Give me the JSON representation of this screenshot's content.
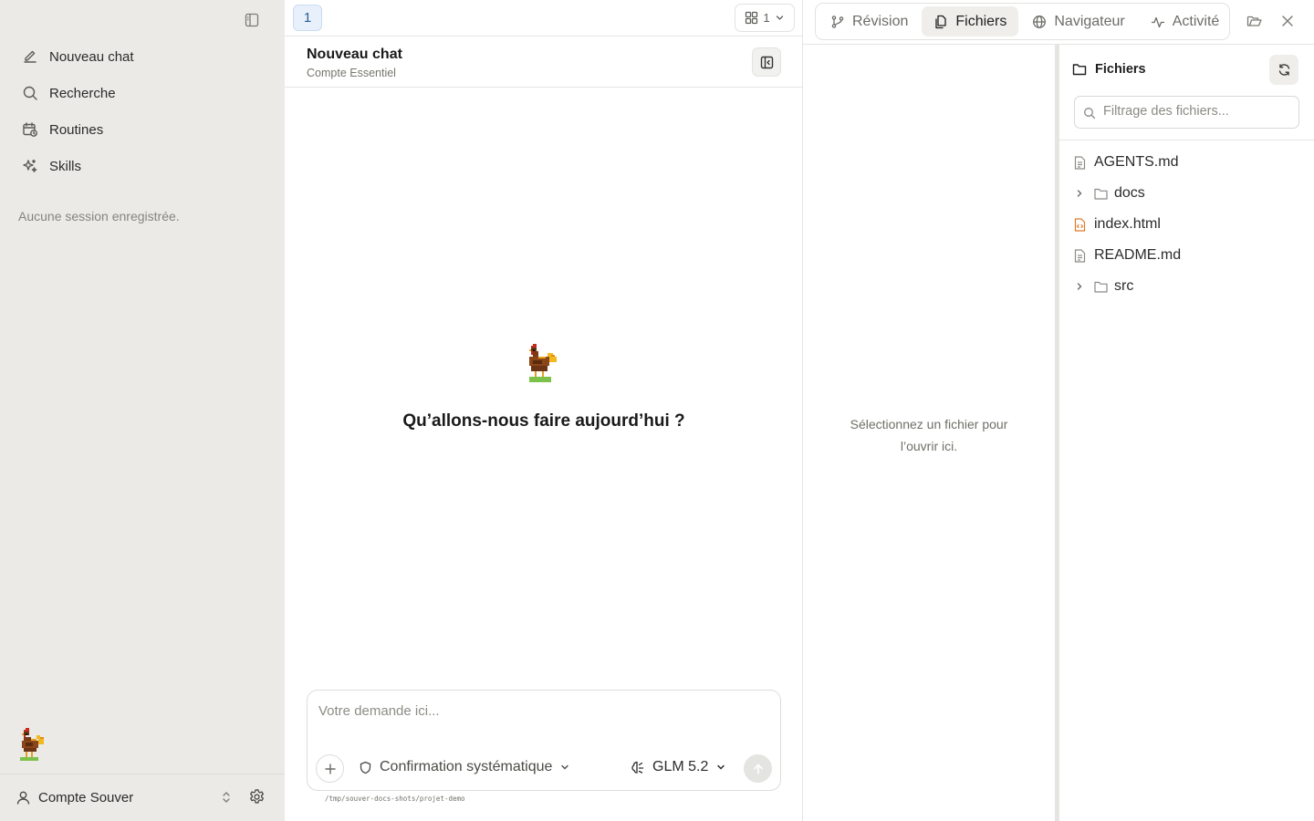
{
  "sidebar": {
    "nav": [
      {
        "label": "Nouveau chat",
        "icon": "pencil-icon"
      },
      {
        "label": "Recherche",
        "icon": "search-icon"
      },
      {
        "label": "Routines",
        "icon": "calendar-clock-icon"
      },
      {
        "label": "Skills",
        "icon": "sparkles-icon"
      }
    ],
    "empty_sessions": "Aucune session enregistrée.",
    "account_name": "Compte Souver"
  },
  "chat": {
    "tab_number": "1",
    "grid_count": "1",
    "title": "Nouveau chat",
    "subtitle": "Compte Essentiel",
    "welcome": "Qu’allons-nous faire aujourd’hui ?",
    "composer_placeholder": "Votre demande ici...",
    "confirmation_mode": "Confirmation systématique",
    "model": "GLM 5.2",
    "workspace_path": "/tmp/souver-docs-shots/projet-demo"
  },
  "right_panel": {
    "tabs": [
      {
        "label": "Révision",
        "icon": "git-branch-icon",
        "active": false
      },
      {
        "label": "Fichiers",
        "icon": "files-icon",
        "active": true
      },
      {
        "label": "Navigateur",
        "icon": "globe-icon",
        "active": false
      },
      {
        "label": "Activité",
        "icon": "activity-icon",
        "active": false
      }
    ],
    "viewer_empty": "Sélectionnez un fichier pour l’ouvrir ici.",
    "files_title": "Fichiers",
    "filter_placeholder": "Filtrage des fichiers...",
    "tree": [
      {
        "name": "AGENTS.md",
        "type": "file"
      },
      {
        "name": "docs",
        "type": "folder"
      },
      {
        "name": "index.html",
        "type": "html"
      },
      {
        "name": "README.md",
        "type": "file"
      },
      {
        "name": "src",
        "type": "folder"
      }
    ]
  },
  "colors": {
    "sidebar_bg": "#ebeae6",
    "tab_badge_bg": "#e8f1fb",
    "tab_badge_text": "#2a5d97",
    "html_file_icon": "#e07a2a"
  }
}
